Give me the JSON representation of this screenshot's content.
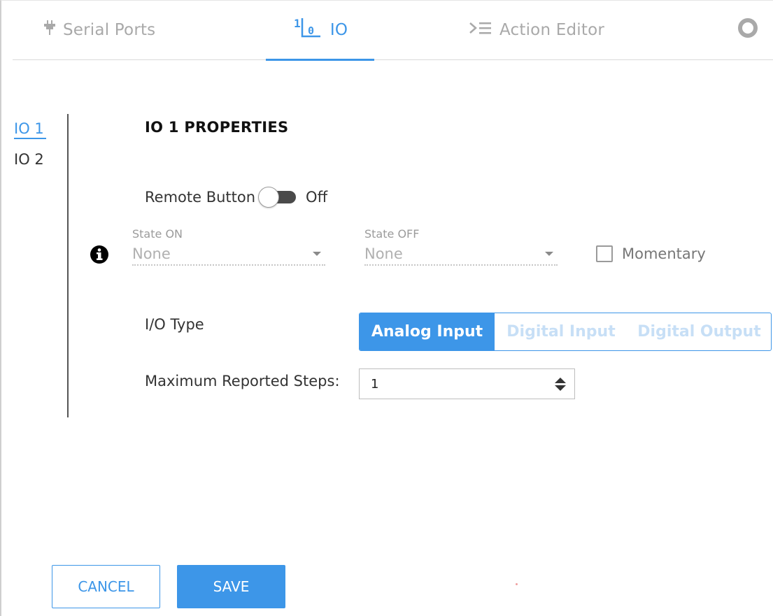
{
  "tabs": [
    {
      "label": "Serial Ports",
      "icon": "plug-icon"
    },
    {
      "label": "IO",
      "icon": "binary-io-icon"
    },
    {
      "label": "Action Editor",
      "icon": "action-list-icon"
    },
    {
      "label": "",
      "icon": "more-ring-icon"
    }
  ],
  "active_tab": "IO",
  "sidenav": {
    "items": [
      "IO 1",
      "IO 2"
    ],
    "active": "IO 1"
  },
  "page_title": "IO 1 PROPERTIES",
  "remote_button": {
    "label": "Remote Button",
    "state": "Off"
  },
  "state_on": {
    "label": "State ON",
    "value": "None"
  },
  "state_off": {
    "label": "State OFF",
    "value": "None"
  },
  "momentary": {
    "label": "Momentary",
    "checked": false
  },
  "io_type": {
    "label": "I/O Type",
    "options": [
      "Analog Input",
      "Digital Input",
      "Digital Output"
    ],
    "selected": "Analog Input"
  },
  "max_steps": {
    "label": "Maximum Reported Steps:",
    "value": "1"
  },
  "footer": {
    "cancel_label": "CANCEL",
    "save_label": "SAVE"
  },
  "colors": {
    "accent": "#3d96e8",
    "muted_text": "#a9a9a9",
    "disabled_option": "#c7dff6"
  }
}
